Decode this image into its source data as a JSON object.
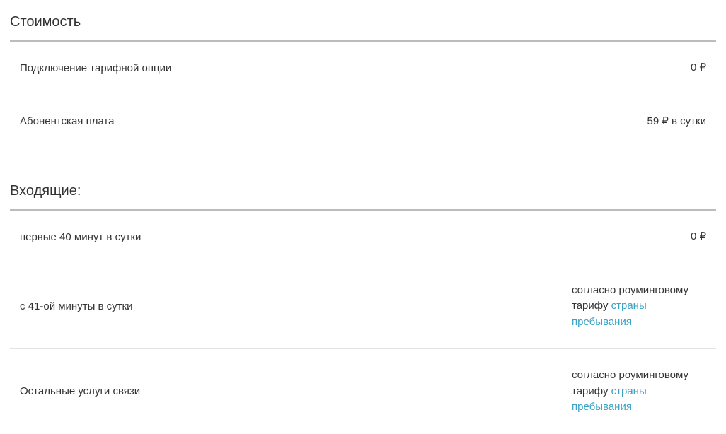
{
  "sections": [
    {
      "title": "Стоимость",
      "rows": [
        {
          "label": "Подключение тарифной опции",
          "value": "0 ₽",
          "hasLink": false
        },
        {
          "label": "Абонентская плата",
          "value": "59 ₽ в сутки",
          "hasLink": false
        }
      ]
    },
    {
      "title": "Входящие:",
      "rows": [
        {
          "label": "первые 40 минут в сутки",
          "value": "0 ₽",
          "hasLink": false
        },
        {
          "label": "с 41-ой минуты в сутки",
          "valuePrefix": "согласно роуминговому тарифу ",
          "linkText": "страны пребывания",
          "hasLink": true
        },
        {
          "label": "Остальные услуги связи",
          "valuePrefix": "согласно роуминговому тарифу ",
          "linkText": "страны пребывания",
          "hasLink": true
        }
      ]
    }
  ]
}
